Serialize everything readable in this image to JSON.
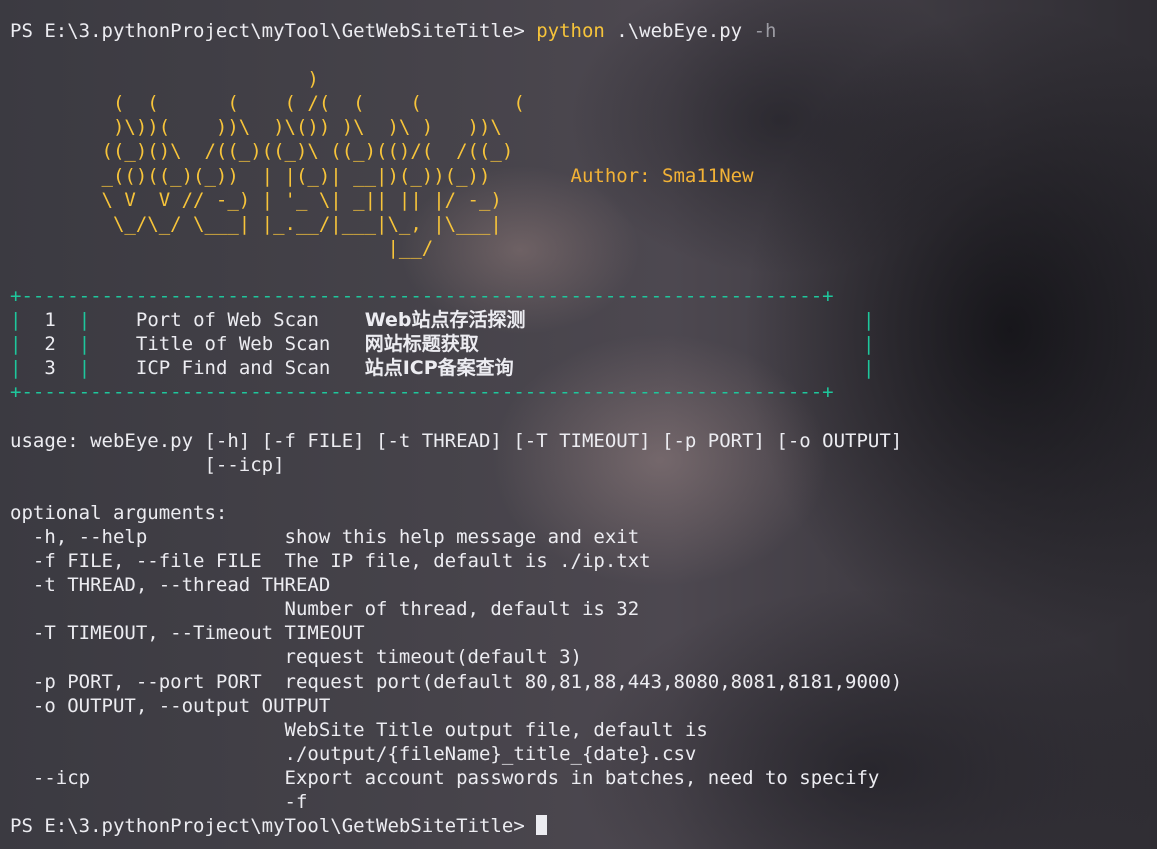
{
  "prompt": {
    "path": "PS E:\\3.pythonProject\\myTool\\GetWebSiteTitle> ",
    "command": "python",
    "arg": " .\\webEye.py",
    "flag": " -h"
  },
  "banner": {
    "art": [
      "",
      "                          )",
      "         (  (      (    ( /(  (    (        (",
      "         )\\))(    ))\\  )\\()) )\\  )\\ )   ))\\",
      "        ((_)()\\  /((_)((_)\\ ((_)(()/(  /((_)",
      "        _(()((_)(_))  | |(_)| __|)(_))(_))",
      "        \\ V  V // -_) | '_ \\| _|| || |/ -_)",
      "         \\_/\\_/ \\___| |_.__/|___|\\_, |\\___|",
      "                                 |__/"
    ],
    "author_pad": "       ",
    "author": "Author: Sma11New"
  },
  "menu": {
    "border": "+----------------------------------------------------------------------+",
    "rows": [
      {
        "num": "1",
        "name": "Port of Web Scan   ",
        "desc": "Web站点存活探测"
      },
      {
        "num": "2",
        "name": "Title of Web Scan  ",
        "desc": "网站标题获取"
      },
      {
        "num": "3",
        "name": "ICP Find and Scan  ",
        "desc": "站点ICP备案查询"
      }
    ]
  },
  "help": {
    "lines": [
      "usage: webEye.py [-h] [-f FILE] [-t THREAD] [-T TIMEOUT] [-p PORT] [-o OUTPUT]",
      "                 [--icp]",
      "",
      "optional arguments:",
      "  -h, --help            show this help message and exit",
      "  -f FILE, --file FILE  The IP file, default is ./ip.txt",
      "  -t THREAD, --thread THREAD",
      "                        Number of thread, default is 32",
      "  -T TIMEOUT, --Timeout TIMEOUT",
      "                        request timeout(default 3)",
      "  -p PORT, --port PORT  request port(default 80,81,88,443,8080,8081,8181,9000)",
      "  -o OUTPUT, --output OUTPUT",
      "                        WebSite Title output file, default is",
      "                        ./output/{fileName}_title_{date}.csv",
      "  --icp                 Export account passwords in batches, need to specify",
      "                        -f"
    ]
  },
  "final_prompt": "PS E:\\3.pythonProject\\myTool\\GetWebSiteTitle> ",
  "colors": {
    "banner": "#f7c43a",
    "author": "#f2b236",
    "menu_border": "#1ec79c",
    "command": "#f7c43a",
    "flag": "#9c9ca3",
    "text": "#ececf1"
  }
}
